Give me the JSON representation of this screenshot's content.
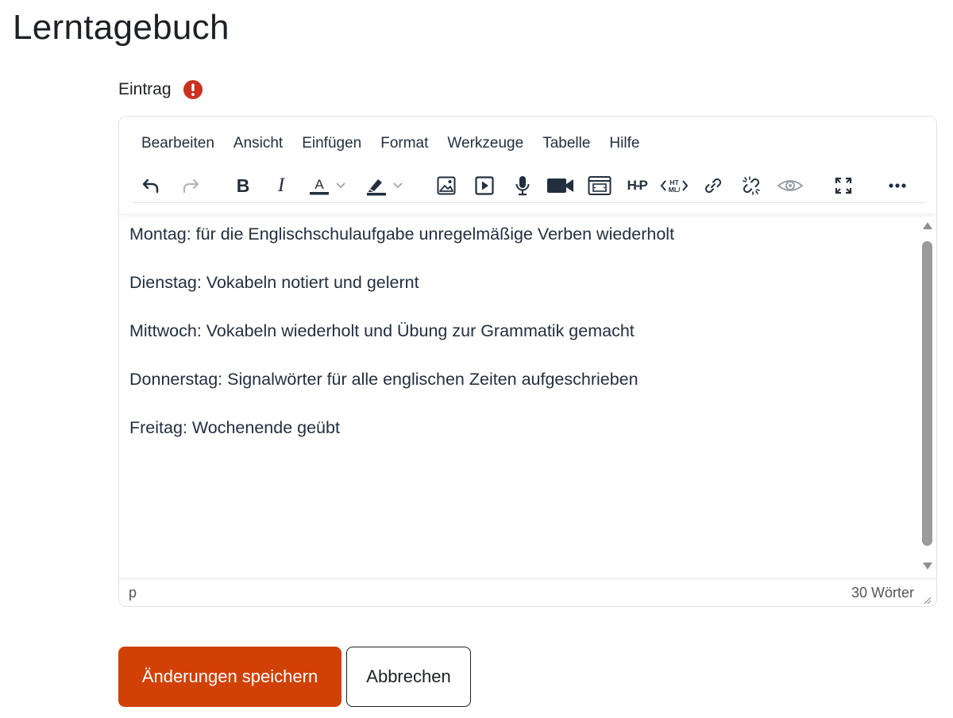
{
  "page": {
    "title": "Lerntagebuch"
  },
  "field": {
    "label": "Eintrag",
    "required_icon": "exclamation-circle-icon",
    "required_color": "#ca3120"
  },
  "editor": {
    "menu": [
      "Bearbeiten",
      "Ansicht",
      "Einfügen",
      "Format",
      "Werkzeuge",
      "Tabelle",
      "Hilfe"
    ],
    "toolbar": [
      "undo-icon",
      "redo-icon",
      "bold-icon",
      "italic-icon",
      "text-color-icon",
      "text-color-dropdown-icon",
      "highlight-color-icon",
      "highlight-color-dropdown-icon",
      "image-icon",
      "media-icon",
      "record-audio-icon",
      "record-video-icon",
      "embed-icon",
      "h5p-icon",
      "html-icon",
      "link-icon",
      "unlink-icon",
      "preview-icon",
      "fullscreen-icon",
      "more-icon"
    ],
    "content": [
      "Montag: für die Englischschulaufgabe unregelmäßige Verben wiederholt",
      "Dienstag: Vokabeln notiert und gelernt",
      "Mittwoch: Vokabeln wiederholt und Übung zur Grammatik gemacht",
      "Donnerstag: Signalwörter für alle englischen Zeiten aufgeschrieben",
      "Freitag: Wochenende geübt"
    ],
    "status": {
      "path": "p",
      "word_count": "30 Wörter"
    }
  },
  "actions": {
    "save_label": "Änderungen speichern",
    "cancel_label": "Abbrechen",
    "primary_color": "#d14105"
  }
}
